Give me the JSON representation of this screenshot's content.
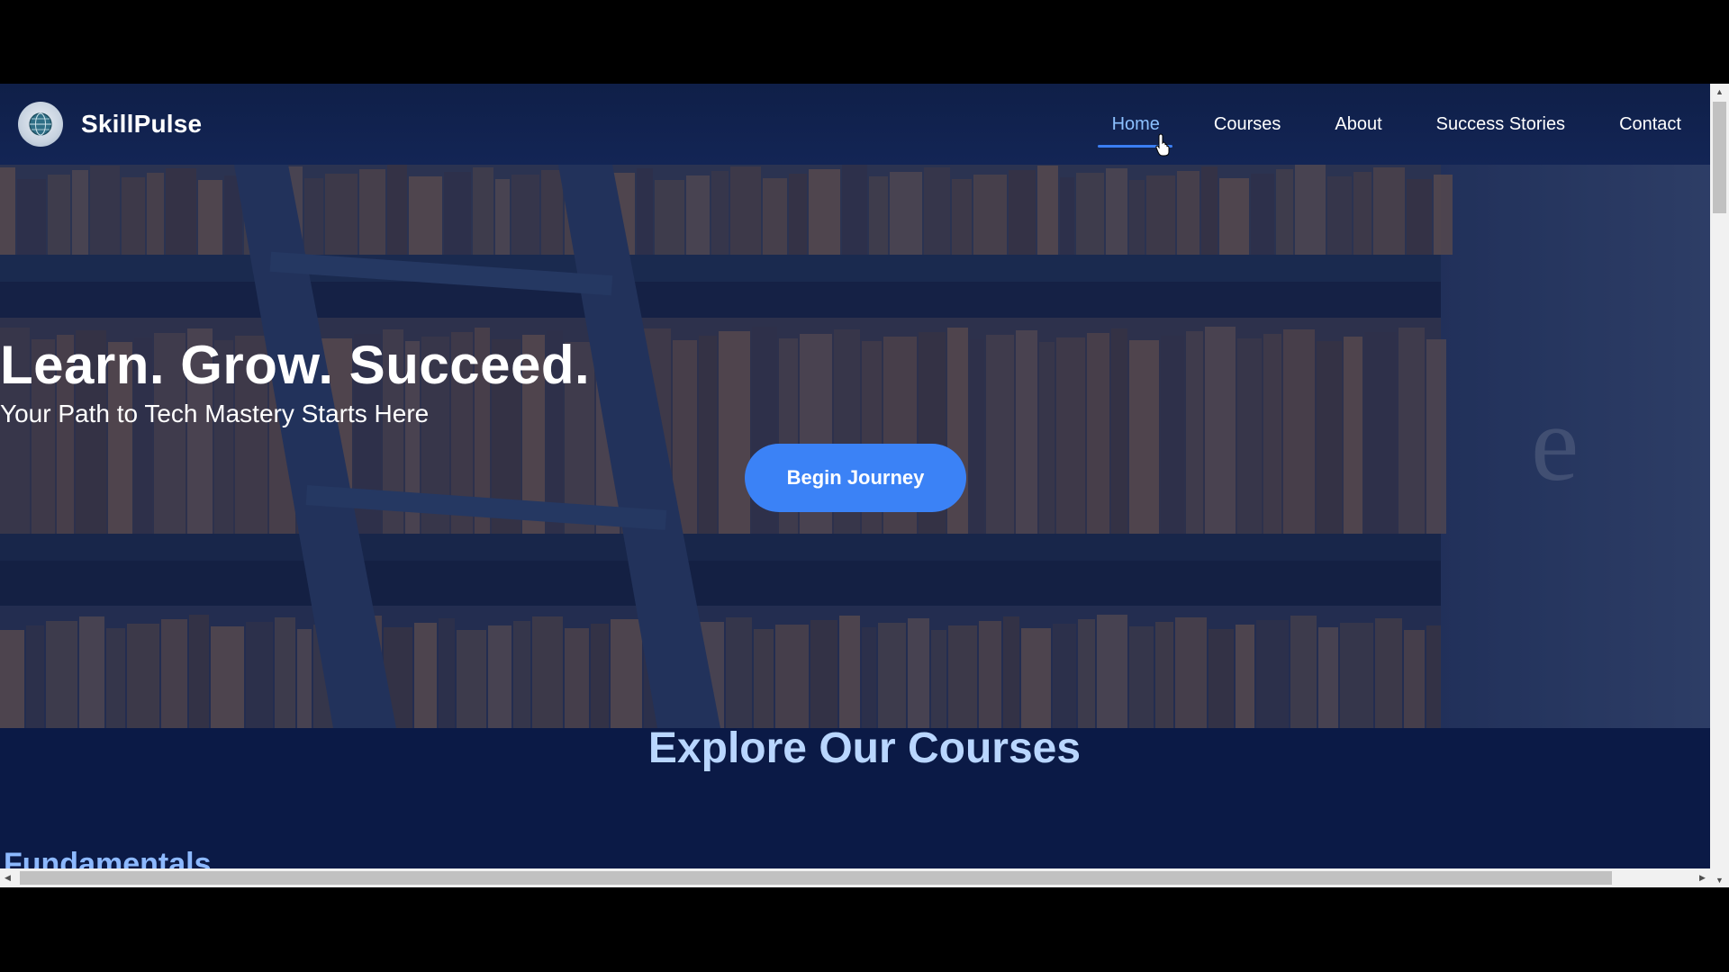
{
  "brand": {
    "name": "SkillPulse",
    "logo_icon": "globe-emblem-icon"
  },
  "nav": {
    "items": [
      {
        "label": "Home",
        "active": true
      },
      {
        "label": "Courses"
      },
      {
        "label": "About"
      },
      {
        "label": "Success Stories"
      },
      {
        "label": "Contact"
      }
    ]
  },
  "hero": {
    "title": "Learn. Grow. Succeed.",
    "subtitle": "Your Path to Tech Mastery Starts Here",
    "cta_label": "Begin Journey",
    "background": "library-bookshelf-image"
  },
  "sections": {
    "explore_title": "Explore Our Courses",
    "first_category": "Fundamentals"
  },
  "colors": {
    "accent": "#3b82f6",
    "active_nav": "#8cc1ff",
    "heading_light": "#b9d6ff",
    "category_title": "#8db9ff",
    "page_bg": "#0b1a46"
  }
}
